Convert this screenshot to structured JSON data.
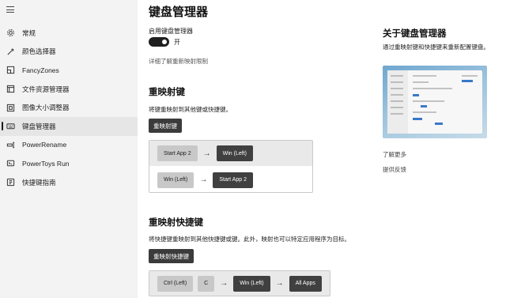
{
  "sidebar": {
    "items": [
      {
        "icon": "gear-icon",
        "label": "常规",
        "active": false
      },
      {
        "icon": "color-picker-icon",
        "label": "颜色选择器",
        "active": false
      },
      {
        "icon": "fancyzones-icon",
        "label": "FancyZones",
        "active": false
      },
      {
        "icon": "file-explorer-icon",
        "label": "文件资源管理器",
        "active": false
      },
      {
        "icon": "image-resizer-icon",
        "label": "图像大小调整器",
        "active": false
      },
      {
        "icon": "keyboard-icon",
        "label": "键盘管理器",
        "active": true
      },
      {
        "icon": "power-rename-icon",
        "label": "PowerRename",
        "active": false
      },
      {
        "icon": "powertoys-run-icon",
        "label": "PowerToys Run",
        "active": false
      },
      {
        "icon": "shortcut-guide-icon",
        "label": "快捷键指南",
        "active": false
      }
    ]
  },
  "main": {
    "title": "键盘管理器",
    "enable_label": "启用键盘管理器",
    "toggle_state": "开",
    "learn_link": "详细了解重新映射限制",
    "remap_keys": {
      "title": "重映射键",
      "desc": "将键重映射到其他键或快捷键。",
      "button": "重映射键",
      "rows": [
        {
          "from": "Start App 2",
          "to": "Win (Left)"
        },
        {
          "from": "Win (Left)",
          "to": "Start App 2"
        }
      ]
    },
    "remap_shortcuts": {
      "title": "重映射快捷键",
      "desc": "将快捷键重映射到其他快捷键或键。此外，映射也可以特定应用程序为目标。",
      "button": "重映射快捷键",
      "row": {
        "from_1": "Ctrl (Left)",
        "from_2": "C",
        "to": "Win (Left)",
        "target": "All Apps"
      }
    }
  },
  "aside": {
    "title": "关于键盘管理器",
    "desc": "通过重映射键和快捷键来重新配置键盘。",
    "learn_more": "了解更多",
    "feedback": "提供反馈"
  },
  "colors": {
    "accent": "#1f1f1f",
    "sidebar_bg": "#f3f3f3",
    "key_dark": "#404040",
    "key_light": "#c8c8c8"
  }
}
